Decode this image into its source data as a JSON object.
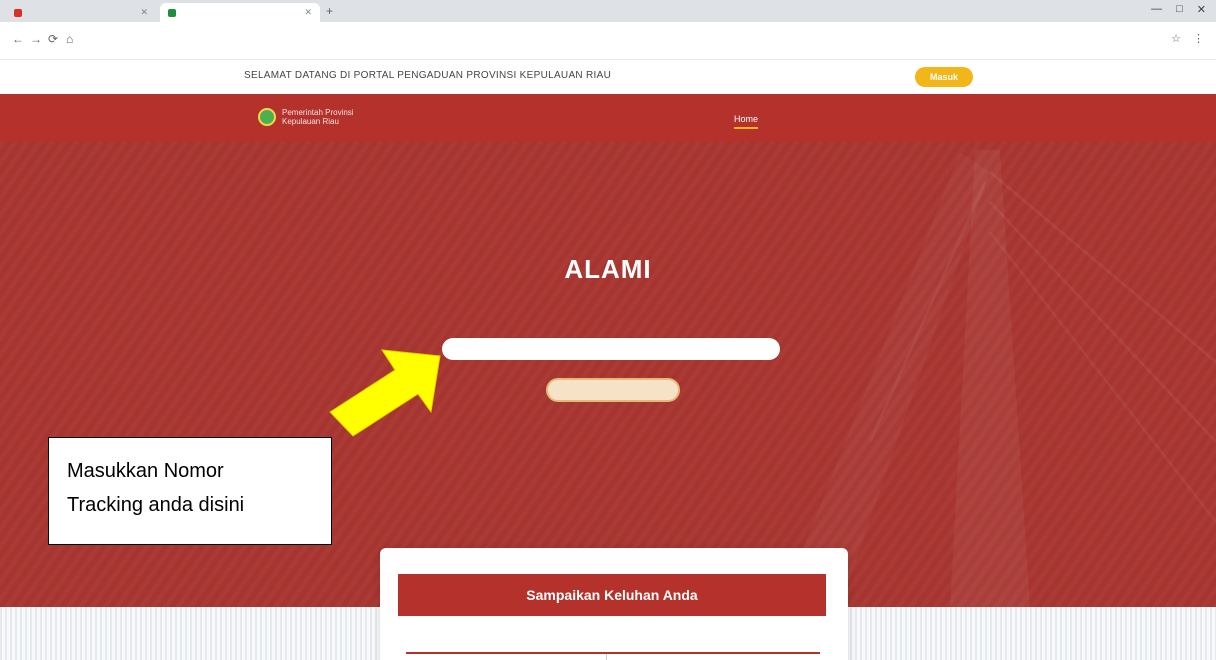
{
  "browser": {
    "tabs": [
      {
        "label": "",
        "active": false
      },
      {
        "label": "",
        "active": true
      }
    ],
    "new_tab": "+",
    "window_controls": [
      "—",
      "□",
      "✕"
    ],
    "nav": {
      "back": "←",
      "forward": "→",
      "reload": "⟳",
      "home": "⌂"
    },
    "url": "",
    "extensions": [
      "☆",
      "⋮"
    ]
  },
  "announcement": {
    "text": "SELAMAT DATANG DI PORTAL PENGADUAN PROVINSI KEPULAUAN RIAU",
    "button": "Masuk"
  },
  "site": {
    "logo_lines": [
      "Pemerintah Provinsi",
      "Kepulauan Riau"
    ],
    "menu": [
      "Home",
      "",
      ""
    ]
  },
  "hero": {
    "title": "ALAMI",
    "subtitle": "",
    "search_placeholder": "",
    "button": ""
  },
  "card": {
    "heading": "Sampaikan Keluhan Anda",
    "subheading": ""
  },
  "annotation": {
    "line1": "Masukkan Nomor",
    "line2": "Tracking anda disini",
    "arrow_color": "#ffff00"
  },
  "colors": {
    "brand_red": "#b5312b",
    "hero_red": "#a6342f",
    "accent_yellow": "#f2b619"
  }
}
